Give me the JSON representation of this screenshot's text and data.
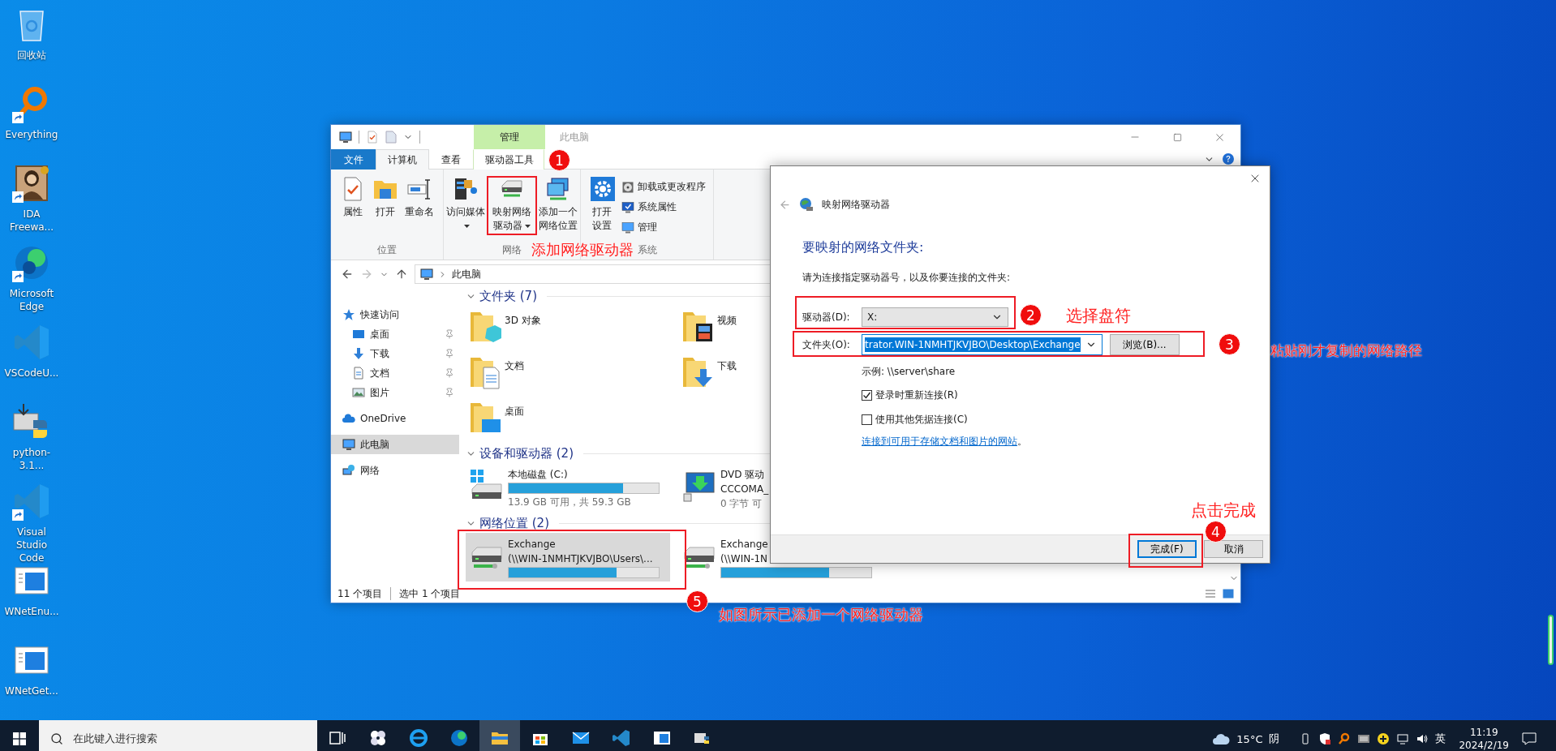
{
  "desktop_icons": [
    {
      "label": "回收站",
      "kind": "recycle",
      "shortcut": false
    },
    {
      "label": "Everything",
      "kind": "search",
      "shortcut": true
    },
    {
      "label": "IDA Freewa...",
      "kind": "portrait",
      "shortcut": true
    },
    {
      "label": "Microsoft Edge",
      "kind": "edge",
      "shortcut": true
    },
    {
      "label": "VSCodeU...",
      "kind": "vscode",
      "shortcut": false
    },
    {
      "label": "python-3.1...",
      "kind": "installer",
      "shortcut": false
    },
    {
      "label": "Visual Studio Code",
      "kind": "vscode",
      "shortcut": true
    },
    {
      "label": "WNetEnu...",
      "kind": "app",
      "shortcut": false
    },
    {
      "label": "WNetGet...",
      "kind": "app",
      "shortcut": false
    }
  ],
  "explorer": {
    "title": "此电脑",
    "context_tab": "管理",
    "tabs": [
      {
        "label": "文件",
        "kind": "file",
        "selected": false
      },
      {
        "label": "计算机",
        "kind": "tab",
        "selected": true
      },
      {
        "label": "查看",
        "kind": "tab",
        "selected": false
      },
      {
        "label": "驱动器工具",
        "kind": "context",
        "selected": false
      }
    ],
    "ribbon": [
      {
        "label": "位置",
        "buttons": [
          {
            "label": "属性",
            "kind": "properties",
            "dropdown": false
          },
          {
            "label": "打开",
            "kind": "open",
            "dropdown": false
          },
          {
            "label": "重命名",
            "kind": "rename",
            "dropdown": false
          }
        ]
      },
      {
        "label": "网络",
        "buttons": [
          {
            "label": "访问媒体",
            "kind": "media",
            "dropdown": true
          },
          {
            "label": "映射网络驱动器",
            "kind": "map-drive",
            "dropdown": true
          },
          {
            "label": "添加一个网络位置",
            "kind": "add-location",
            "dropdown": false
          }
        ]
      },
      {
        "label": "系统",
        "buttons": [
          {
            "label": "打开设置",
            "kind": "settings",
            "dropdown": false
          }
        ],
        "small_buttons": [
          {
            "label": "卸载或更改程序",
            "kind": "uninstall"
          },
          {
            "label": "系统属性",
            "kind": "sysprops"
          },
          {
            "label": "管理",
            "kind": "manage"
          }
        ]
      }
    ],
    "address": "此电脑",
    "nav": [
      {
        "label": "快速访问",
        "kind": "star",
        "selected": false,
        "children": [
          {
            "label": "桌面",
            "kind": "desktop",
            "pinned": true,
            "selected": false
          },
          {
            "label": "下载",
            "kind": "download",
            "pinned": true,
            "selected": false
          },
          {
            "label": "文档",
            "kind": "docs",
            "pinned": true,
            "selected": false
          },
          {
            "label": "图片",
            "kind": "pictures",
            "pinned": true,
            "selected": false
          }
        ]
      },
      {
        "label": "OneDrive",
        "kind": "cloud",
        "selected": false
      },
      {
        "label": "此电脑",
        "kind": "pc",
        "selected": true
      },
      {
        "label": "网络",
        "kind": "network",
        "selected": false
      }
    ],
    "sections": [
      {
        "title": "文件夹 (7)",
        "items": [
          {
            "kind": "cube-folder",
            "label": "3D 对象",
            "selected": false
          },
          {
            "kind": "film-folder",
            "label": "视频",
            "selected": false
          },
          {
            "kind": "document-folder",
            "label": "文档",
            "selected": false
          },
          {
            "kind": "arrow-folder",
            "label": "下载",
            "selected": false
          },
          {
            "kind": "screen-folder",
            "label": "桌面",
            "selected": false
          }
        ]
      },
      {
        "title": "设备和驱动器 (2)",
        "items": [
          {
            "kind": "disk",
            "label": "本地磁盘 (C:)",
            "level": 0.76,
            "detail": "13.9 GB 可用，共 59.3 GB",
            "selected": false
          },
          {
            "kind": "dvd",
            "label": "DVD 驱动",
            "line2": "CCCOMA_",
            "detail": "0 字节 可",
            "selected": false
          }
        ]
      },
      {
        "title": "网络位置 (2)",
        "items": [
          {
            "kind": "network",
            "label": "Exchange",
            "line2": "(\\\\WIN-1NMHTJKVJBO\\Users\\...",
            "level": 0.72,
            "selected": true
          },
          {
            "kind": "network",
            "label": "Exchange",
            "line2": "(\\\\WIN-1N",
            "level": 0.72,
            "selected": false
          }
        ]
      }
    ],
    "status": {
      "count": "11 个项目",
      "selection": "选中 1 个项目"
    }
  },
  "dialog": {
    "title": "映射网络驱动器",
    "heading": "要映射的网络文件夹:",
    "instruction": "请为连接指定驱动器号，以及你要连接的文件夹:",
    "drive_label": "驱动器(D):",
    "drive_value": "X:",
    "folder_label": "文件夹(O):",
    "folder_value": "trator.WIN-1NMHTJKVJBO\\Desktop\\Exchange",
    "folder_value_selected": true,
    "browse": "浏览(B)...",
    "example": "示例: \\\\server\\share",
    "options": [
      {
        "label": "登录时重新连接(R)",
        "checked": true
      },
      {
        "label": "使用其他凭据连接(C)",
        "checked": false
      }
    ],
    "link": "连接到可用于存储文档和图片的网站",
    "link_suffix": "。",
    "buttons": [
      {
        "label": "完成(F)",
        "default": true
      },
      {
        "label": "取消",
        "default": false
      }
    ]
  },
  "annotations": [
    {
      "number": "1",
      "note": "添加网络驱动器"
    },
    {
      "number": "2",
      "note": "选择盘符"
    },
    {
      "number": "3",
      "note": "粘贴刚才复制的网络路径"
    },
    {
      "number": "4",
      "note": "点击完成"
    },
    {
      "number": "5",
      "note": "如图所示已添加一个网络驱动器"
    }
  ],
  "taskbar": {
    "search": {
      "placeholder": "在此键入进行搜索"
    },
    "apps": [
      {
        "kind": "taskview",
        "selected": false
      },
      {
        "kind": "pinwheel",
        "selected": false
      },
      {
        "kind": "ie",
        "selected": false
      },
      {
        "kind": "edge",
        "selected": false
      },
      {
        "kind": "explorer",
        "selected": true
      },
      {
        "kind": "store",
        "selected": false
      },
      {
        "kind": "mail",
        "selected": false
      },
      {
        "kind": "vscode",
        "selected": false
      },
      {
        "kind": "app",
        "selected": false
      },
      {
        "kind": "installer",
        "selected": false
      }
    ],
    "temperature": "15°C",
    "weather": "阴",
    "tray": [
      {
        "kind": "usb"
      },
      {
        "kind": "shield"
      },
      {
        "kind": "magnifier"
      },
      {
        "kind": "vm"
      },
      {
        "kind": "plus"
      },
      {
        "kind": "network"
      },
      {
        "kind": "volume"
      }
    ],
    "ime": "英",
    "time": "11:19",
    "date": "2024/2/19"
  }
}
